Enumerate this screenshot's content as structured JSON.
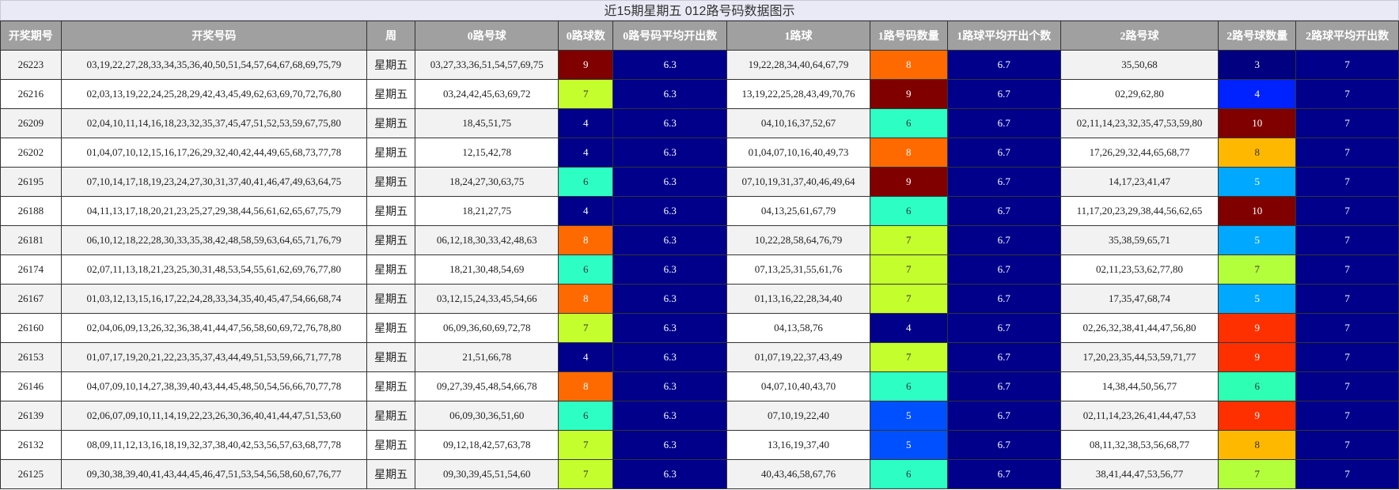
{
  "title": "近15期星期五 012路号码数据图示",
  "headers": [
    "开奖期号",
    "开奖号码",
    "周",
    "0路号球",
    "0路球数",
    "0路号码平均开出数",
    "1路球",
    "1路号码数量",
    "1路球平均开出个数",
    "2路号球",
    "2路号球数量",
    "2路球平均开出数"
  ],
  "colors": {
    "3": "#000080",
    "4": "#00008b",
    "5": "#00a2ff",
    "6": "#2dffc4",
    "7": "#c4ff2d",
    "8": "#ff6a00",
    "9": "#800000",
    "10": "#800000",
    "one_4": "#00008b",
    "one_5": "#0050ff",
    "one_8": "#ff6a00",
    "one_9": "#800000",
    "two_4": "#0022ff",
    "two_5": "#00a8ff",
    "two_6": "#2dffb4",
    "two_7": "#b4ff3c",
    "two_8": "#ffb800",
    "two_9": "#ff3000",
    "two_10": "#800000",
    "avg": "#00008b"
  },
  "rows": [
    {
      "issue": "26223",
      "numbers": "03,19,22,27,28,33,34,35,36,40,50,51,54,57,64,67,68,69,75,79",
      "week": "星期五",
      "r0": "03,27,33,36,51,54,57,69,75",
      "c0": "9",
      "a0": "6.3",
      "r1": "19,22,28,34,40,64,67,79",
      "c1": "8",
      "a1": "6.7",
      "r2": "35,50,68",
      "c2": "3",
      "a2": "7"
    },
    {
      "issue": "26216",
      "numbers": "02,03,13,19,22,24,25,28,29,42,43,45,49,62,63,69,70,72,76,80",
      "week": "星期五",
      "r0": "03,24,42,45,63,69,72",
      "c0": "7",
      "a0": "6.3",
      "r1": "13,19,22,25,28,43,49,70,76",
      "c1": "9",
      "a1": "6.7",
      "r2": "02,29,62,80",
      "c2": "4",
      "a2": "7"
    },
    {
      "issue": "26209",
      "numbers": "02,04,10,11,14,16,18,23,32,35,37,45,47,51,52,53,59,67,75,80",
      "week": "星期五",
      "r0": "18,45,51,75",
      "c0": "4",
      "a0": "6.3",
      "r1": "04,10,16,37,52,67",
      "c1": "6",
      "a1": "6.7",
      "r2": "02,11,14,23,32,35,47,53,59,80",
      "c2": "10",
      "a2": "7"
    },
    {
      "issue": "26202",
      "numbers": "01,04,07,10,12,15,16,17,26,29,32,40,42,44,49,65,68,73,77,78",
      "week": "星期五",
      "r0": "12,15,42,78",
      "c0": "4",
      "a0": "6.3",
      "r1": "01,04,07,10,16,40,49,73",
      "c1": "8",
      "a1": "6.7",
      "r2": "17,26,29,32,44,65,68,77",
      "c2": "8",
      "a2": "7"
    },
    {
      "issue": "26195",
      "numbers": "07,10,14,17,18,19,23,24,27,30,31,37,40,41,46,47,49,63,64,75",
      "week": "星期五",
      "r0": "18,24,27,30,63,75",
      "c0": "6",
      "a0": "6.3",
      "r1": "07,10,19,31,37,40,46,49,64",
      "c1": "9",
      "a1": "6.7",
      "r2": "14,17,23,41,47",
      "c2": "5",
      "a2": "7"
    },
    {
      "issue": "26188",
      "numbers": "04,11,13,17,18,20,21,23,25,27,29,38,44,56,61,62,65,67,75,79",
      "week": "星期五",
      "r0": "18,21,27,75",
      "c0": "4",
      "a0": "6.3",
      "r1": "04,13,25,61,67,79",
      "c1": "6",
      "a1": "6.7",
      "r2": "11,17,20,23,29,38,44,56,62,65",
      "c2": "10",
      "a2": "7"
    },
    {
      "issue": "26181",
      "numbers": "06,10,12,18,22,28,30,33,35,38,42,48,58,59,63,64,65,71,76,79",
      "week": "星期五",
      "r0": "06,12,18,30,33,42,48,63",
      "c0": "8",
      "a0": "6.3",
      "r1": "10,22,28,58,64,76,79",
      "c1": "7",
      "a1": "6.7",
      "r2": "35,38,59,65,71",
      "c2": "5",
      "a2": "7"
    },
    {
      "issue": "26174",
      "numbers": "02,07,11,13,18,21,23,25,30,31,48,53,54,55,61,62,69,76,77,80",
      "week": "星期五",
      "r0": "18,21,30,48,54,69",
      "c0": "6",
      "a0": "6.3",
      "r1": "07,13,25,31,55,61,76",
      "c1": "7",
      "a1": "6.7",
      "r2": "02,11,23,53,62,77,80",
      "c2": "7",
      "a2": "7"
    },
    {
      "issue": "26167",
      "numbers": "01,03,12,13,15,16,17,22,24,28,33,34,35,40,45,47,54,66,68,74",
      "week": "星期五",
      "r0": "03,12,15,24,33,45,54,66",
      "c0": "8",
      "a0": "6.3",
      "r1": "01,13,16,22,28,34,40",
      "c1": "7",
      "a1": "6.7",
      "r2": "17,35,47,68,74",
      "c2": "5",
      "a2": "7"
    },
    {
      "issue": "26160",
      "numbers": "02,04,06,09,13,26,32,36,38,41,44,47,56,58,60,69,72,76,78,80",
      "week": "星期五",
      "r0": "06,09,36,60,69,72,78",
      "c0": "7",
      "a0": "6.3",
      "r1": "04,13,58,76",
      "c1": "4",
      "a1": "6.7",
      "r2": "02,26,32,38,41,44,47,56,80",
      "c2": "9",
      "a2": "7"
    },
    {
      "issue": "26153",
      "numbers": "01,07,17,19,20,21,22,23,35,37,43,44,49,51,53,59,66,71,77,78",
      "week": "星期五",
      "r0": "21,51,66,78",
      "c0": "4",
      "a0": "6.3",
      "r1": "01,07,19,22,37,43,49",
      "c1": "7",
      "a1": "6.7",
      "r2": "17,20,23,35,44,53,59,71,77",
      "c2": "9",
      "a2": "7"
    },
    {
      "issue": "26146",
      "numbers": "04,07,09,10,14,27,38,39,40,43,44,45,48,50,54,56,66,70,77,78",
      "week": "星期五",
      "r0": "09,27,39,45,48,54,66,78",
      "c0": "8",
      "a0": "6.3",
      "r1": "04,07,10,40,43,70",
      "c1": "6",
      "a1": "6.7",
      "r2": "14,38,44,50,56,77",
      "c2": "6",
      "a2": "7"
    },
    {
      "issue": "26139",
      "numbers": "02,06,07,09,10,11,14,19,22,23,26,30,36,40,41,44,47,51,53,60",
      "week": "星期五",
      "r0": "06,09,30,36,51,60",
      "c0": "6",
      "a0": "6.3",
      "r1": "07,10,19,22,40",
      "c1": "5",
      "a1": "6.7",
      "r2": "02,11,14,23,26,41,44,47,53",
      "c2": "9",
      "a2": "7"
    },
    {
      "issue": "26132",
      "numbers": "08,09,11,12,13,16,18,19,32,37,38,40,42,53,56,57,63,68,77,78",
      "week": "星期五",
      "r0": "09,12,18,42,57,63,78",
      "c0": "7",
      "a0": "6.3",
      "r1": "13,16,19,37,40",
      "c1": "5",
      "a1": "6.7",
      "r2": "08,11,32,38,53,56,68,77",
      "c2": "8",
      "a2": "7"
    },
    {
      "issue": "26125",
      "numbers": "09,30,38,39,40,41,43,44,45,46,47,51,53,54,56,58,60,67,76,77",
      "week": "星期五",
      "r0": "09,30,39,45,51,54,60",
      "c0": "7",
      "a0": "6.3",
      "r1": "40,43,46,58,67,76",
      "c1": "6",
      "a1": "6.7",
      "r2": "38,41,44,47,53,56,77",
      "c2": "7",
      "a2": "7"
    }
  ]
}
